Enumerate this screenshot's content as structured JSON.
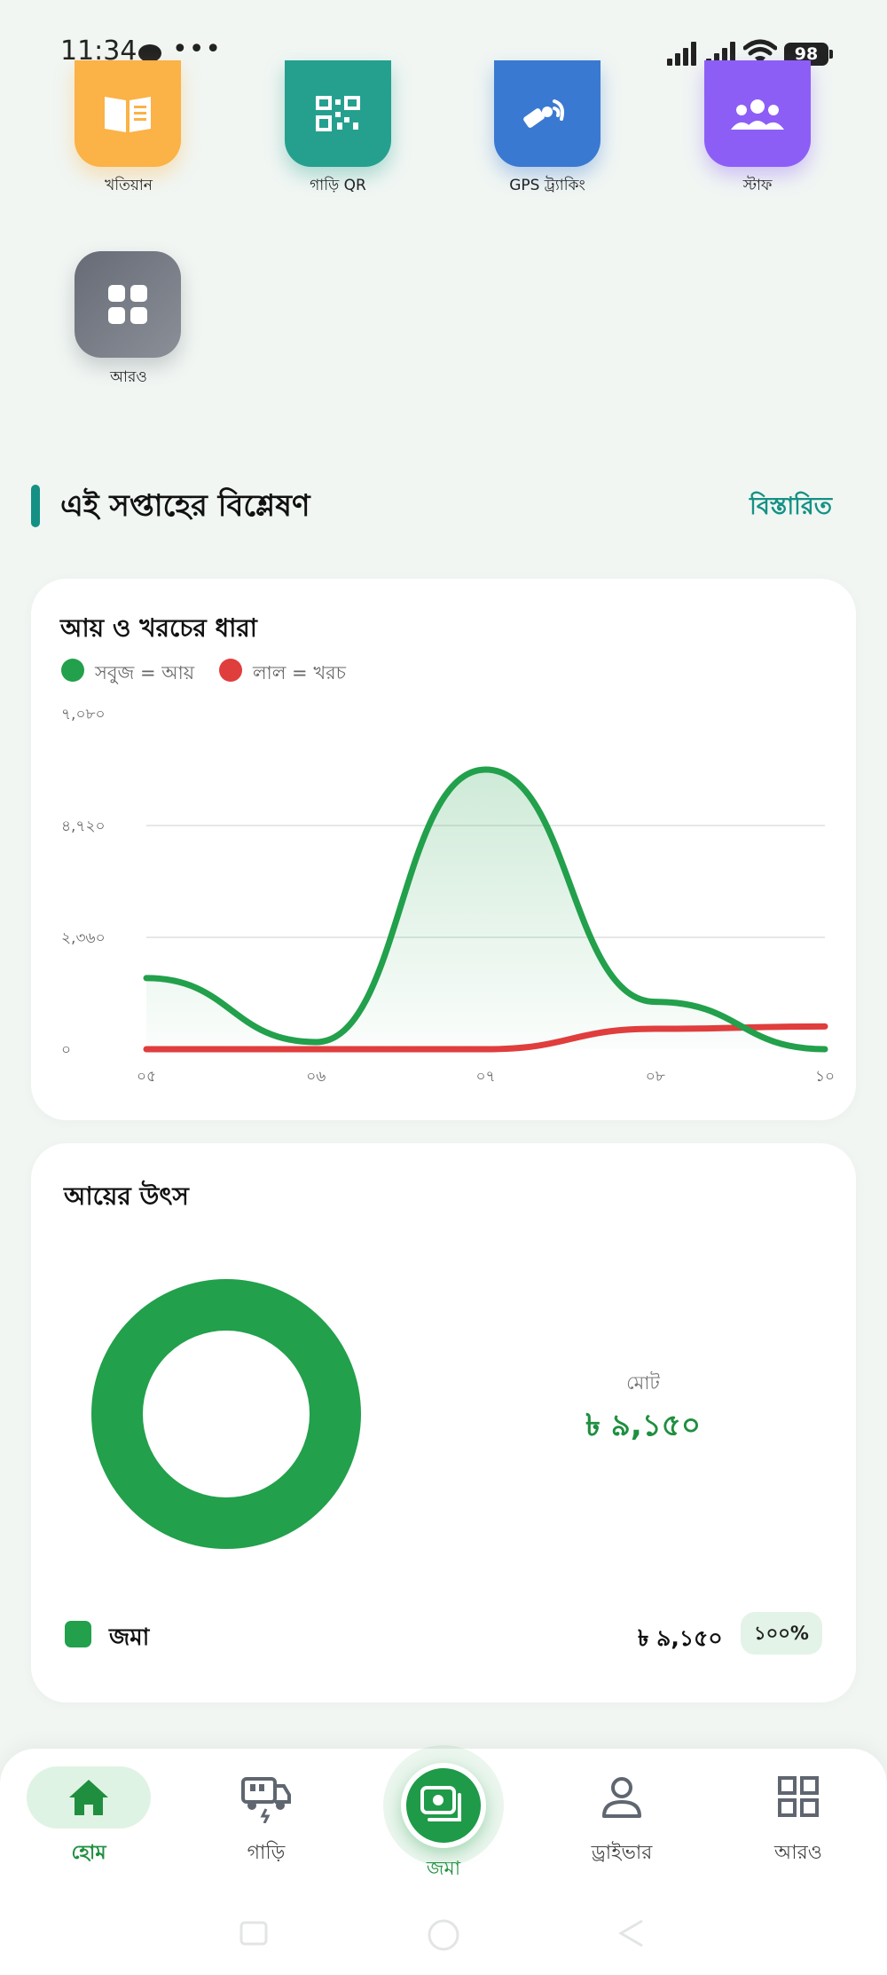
{
  "status_bar": {
    "time": "11:34",
    "dots": "•••",
    "battery": "98"
  },
  "shortcuts": [
    {
      "label": "খতিয়ান",
      "icon": "ledger-book-icon",
      "color": "#fbb246"
    },
    {
      "label": "গাড়ি QR",
      "icon": "qr-code-icon",
      "color": "#25a08f"
    },
    {
      "label": "GPS ট্র্যাকিং",
      "icon": "satellite-icon",
      "color": "#3a79d1"
    },
    {
      "label": "স্টাফ",
      "icon": "staff-group-icon",
      "color": "#8d5ef6"
    },
    {
      "label": "আরও",
      "icon": "grid-icon",
      "color": "#727781"
    }
  ],
  "section": {
    "title": "এই সপ্তাহের বিশ্লেষণ",
    "link": "বিস্তারিত"
  },
  "trend_card": {
    "title": "আয় ও খরচের ধারা",
    "legend_income": "সবুজ = আয়",
    "legend_expense": "লাল = খরচ"
  },
  "chart_data": [
    {
      "type": "area",
      "title": "আয় ও খরচের ধারা",
      "categories": [
        "০৫",
        "০৬",
        "০৭",
        "০৮",
        "১০"
      ],
      "y_ticks": [
        "০",
        "২,৩৬০",
        "৪,৭২০",
        "৭,০৮০"
      ],
      "ylim": [
        0,
        7080
      ],
      "grid": true,
      "legend_position": "top-left",
      "series": [
        {
          "name": "সবুজ = আয়",
          "color": "#22a04b",
          "values": [
            1500,
            150,
            5900,
            1000,
            0
          ]
        },
        {
          "name": "লাল = খরচ",
          "color": "#e03d3d",
          "values": [
            0,
            0,
            0,
            430,
            480
          ]
        }
      ]
    },
    {
      "type": "pie",
      "title": "আয়ের উৎস",
      "categories": [
        "জমা"
      ],
      "values": [
        9150
      ],
      "colors": [
        "#22a04b"
      ]
    }
  ],
  "income_card": {
    "title": "আয়ের উৎস",
    "total_label": "মোট",
    "total_value": "৳ ৯,১৫০",
    "rows": [
      {
        "label": "জমা",
        "amount": "৳ ৯,১৫০",
        "percent": "১০০%",
        "color": "#22a04b"
      }
    ]
  },
  "bottom_nav": {
    "items": [
      {
        "label": "হোম",
        "icon": "home-icon",
        "active": true
      },
      {
        "label": "গাড়ি",
        "icon": "vehicle-icon",
        "active": false
      },
      {
        "label": "জমা",
        "icon": "deposit-icon",
        "active": false
      },
      {
        "label": "ড্রাইভার",
        "icon": "driver-icon",
        "active": false
      },
      {
        "label": "আরও",
        "icon": "more-grid-icon",
        "active": false
      }
    ],
    "accent": "#1f8f3f"
  }
}
